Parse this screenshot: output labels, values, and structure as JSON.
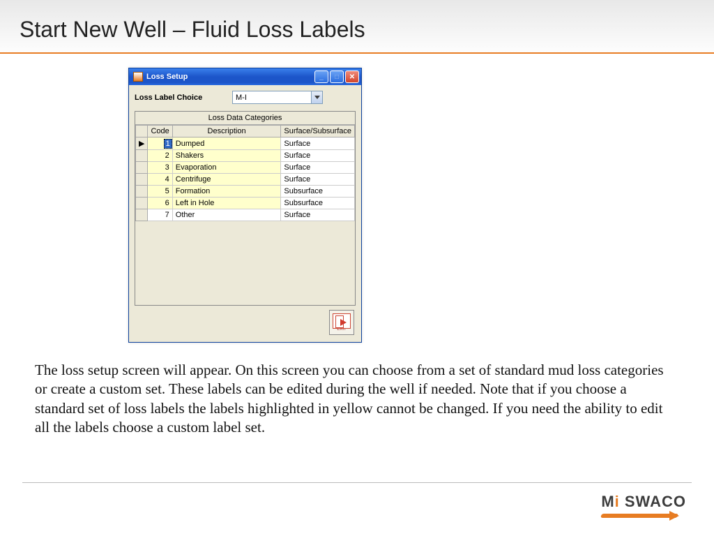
{
  "slide": {
    "title": "Start New Well – Fluid Loss Labels"
  },
  "window": {
    "title": "Loss Setup",
    "choice_label": "Loss Label Choice",
    "choice_value": "M-I",
    "grid_title": "Loss Data Categories",
    "columns": {
      "code": "Code",
      "desc": "Description",
      "loc": "Surface/Subsurface"
    },
    "rows": [
      {
        "code": "1",
        "desc": "Dumped",
        "loc": "Surface",
        "yellow": true,
        "selected": true
      },
      {
        "code": "2",
        "desc": "Shakers",
        "loc": "Surface",
        "yellow": true
      },
      {
        "code": "3",
        "desc": "Evaporation",
        "loc": "Surface",
        "yellow": true
      },
      {
        "code": "4",
        "desc": "Centrifuge",
        "loc": "Surface",
        "yellow": true
      },
      {
        "code": "5",
        "desc": "Formation",
        "loc": "Subsurface",
        "yellow": true
      },
      {
        "code": "6",
        "desc": "Left in Hole",
        "loc": "Subsurface",
        "yellow": true
      },
      {
        "code": "7",
        "desc": "Other",
        "loc": "Surface",
        "yellow": false
      }
    ],
    "exit_label": "EXIT"
  },
  "paragraph": "The loss setup screen will appear. On this screen you can choose from a set of standard mud loss categories or create a custom set. These labels can be edited during the well if needed. Note that if you choose a standard set of loss labels the labels highlighted in yellow cannot be changed. If you need the ability to edit all the labels choose a custom label set.",
  "brand": {
    "part1": "M",
    "part2": "i",
    "part3": " SWACO"
  }
}
